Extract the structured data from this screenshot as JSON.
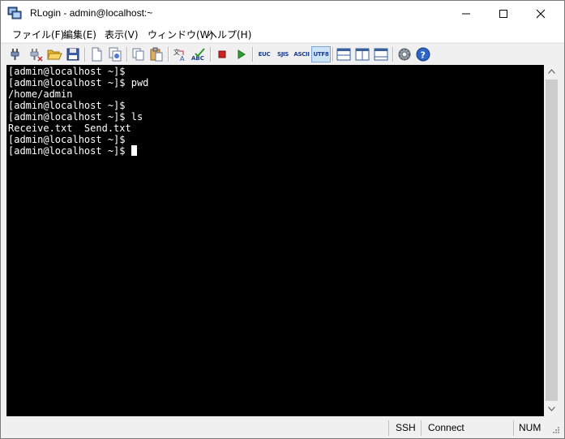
{
  "window": {
    "title": "RLogin - admin@localhost:~"
  },
  "menu": [
    {
      "label": "ファイル(F)"
    },
    {
      "label": "編集(E)"
    },
    {
      "label": "表示(V)"
    },
    {
      "label": "ウィンドウ(W)"
    },
    {
      "label": "ヘルプ(H)"
    }
  ],
  "toolbar": {
    "encodings": [
      "EUC",
      "SJIS",
      "ASCII",
      "UTF8"
    ],
    "active_encoding": "UTF8"
  },
  "terminal": {
    "lines": [
      "[admin@localhost ~]$",
      "[admin@localhost ~]$ pwd",
      "/home/admin",
      "[admin@localhost ~]$",
      "[admin@localhost ~]$ ls",
      "Receive.txt  Send.txt",
      "[admin@localhost ~]$",
      "[admin@localhost ~]$ "
    ]
  },
  "status": {
    "protocol": "SSH",
    "connection": "Connect",
    "numlock": "NUM"
  }
}
